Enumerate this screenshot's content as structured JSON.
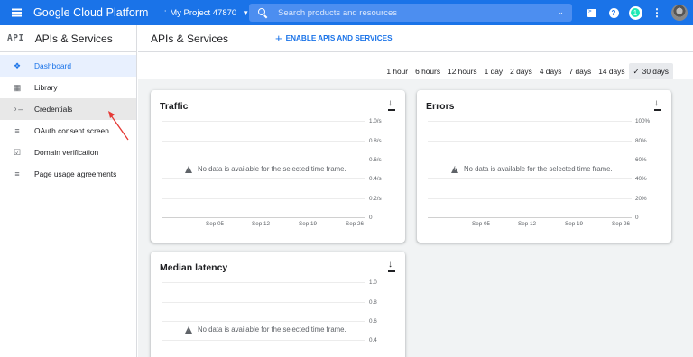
{
  "topbar": {
    "brand": "Google Cloud Platform",
    "project": "My Project 47870",
    "search_placeholder": "Search products and resources",
    "notification_count": "1",
    "colors": {
      "bar": "#1a73e8",
      "badge": "#1de9b6"
    },
    "icons": [
      "menu-icon",
      "project-icon",
      "search-icon",
      "chevron-down-icon",
      "cloud-shell-icon",
      "help-icon",
      "notification-icon",
      "more-vert-icon",
      "avatar"
    ]
  },
  "sidebar": {
    "logo": "API",
    "title": "APIs & Services",
    "items": [
      {
        "label": "Dashboard",
        "icon": "dashboard-icon",
        "active": true
      },
      {
        "label": "Library",
        "icon": "library-icon"
      },
      {
        "label": "Credentials",
        "icon": "key-icon",
        "hovered": true
      },
      {
        "label": "OAuth consent screen",
        "icon": "consent-icon"
      },
      {
        "label": "Domain verification",
        "icon": "checkbox-icon"
      },
      {
        "label": "Page usage agreements",
        "icon": "settings-list-icon"
      }
    ]
  },
  "main": {
    "title": "APIs & Services",
    "enable_button": "ENABLE APIS AND SERVICES",
    "time_ranges": [
      "1 hour",
      "6 hours",
      "12 hours",
      "1 day",
      "2 days",
      "4 days",
      "7 days",
      "14 days",
      "30 days"
    ],
    "selected_range": "30 days",
    "no_data_message": "No data is available for the selected time frame.",
    "x_ticks": [
      "Sep 05",
      "Sep 12",
      "Sep 19",
      "Sep 26"
    ],
    "cards": [
      {
        "title": "Traffic",
        "y_ticks": [
          "1.0/s",
          "0.8/s",
          "0.6/s",
          "0.4/s",
          "0.2/s",
          "0"
        ]
      },
      {
        "title": "Errors",
        "y_ticks": [
          "100%",
          "80%",
          "60%",
          "40%",
          "20%",
          "0"
        ]
      },
      {
        "title": "Median latency",
        "y_ticks": [
          "1.0",
          "0.8",
          "0.6",
          "0.4"
        ]
      }
    ]
  }
}
